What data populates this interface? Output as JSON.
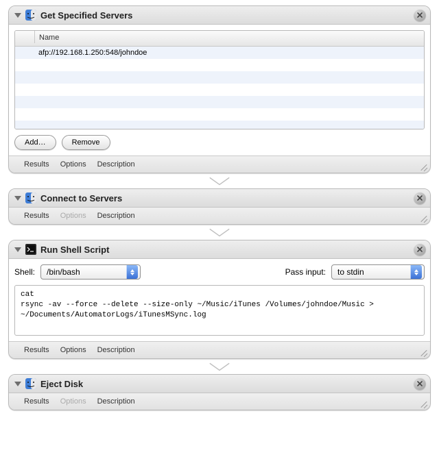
{
  "footer": {
    "results": "Results",
    "options": "Options",
    "description": "Description"
  },
  "actions": {
    "get_servers": {
      "title": "Get Specified Servers",
      "column_header": "Name",
      "rows": [
        "afp://192.168.1.250:548/johndoe"
      ],
      "add_label": "Add…",
      "remove_label": "Remove"
    },
    "connect_servers": {
      "title": "Connect to Servers"
    },
    "run_shell": {
      "title": "Run Shell Script",
      "shell_label": "Shell:",
      "shell_value": "/bin/bash",
      "pass_label": "Pass input:",
      "pass_value": "to stdin",
      "script": "cat\nrsync -av --force --delete --size-only ~/Music/iTunes /Volumes/johndoe/Music > ~/Documents/AutomatorLogs/iTunesMSync.log"
    },
    "eject_disk": {
      "title": "Eject Disk"
    }
  }
}
